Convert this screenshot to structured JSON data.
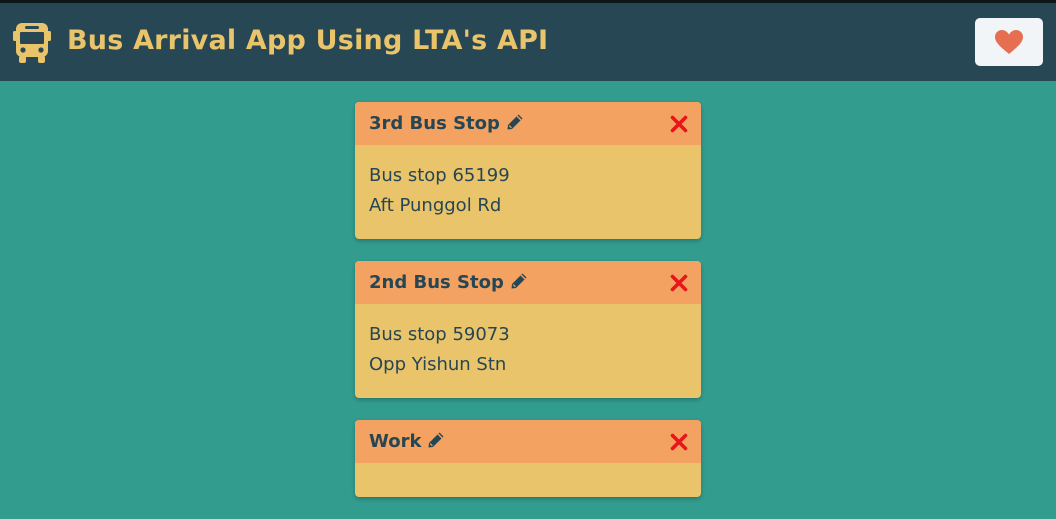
{
  "app": {
    "title": "Bus Arrival App Using LTA's API",
    "logo_icon": "bus-icon",
    "favorite_icon": "heart-icon"
  },
  "colors": {
    "background": "#329d8f",
    "navbar": "#274754",
    "title": "#e9c46a",
    "card_header": "#f4a261",
    "card_body": "#e9c46a",
    "text": "#264653",
    "delete": "#e8161b",
    "heart": "#e76f51"
  },
  "cards": [
    {
      "title": "3rd Bus Stop",
      "stop_line": "Bus stop 65199",
      "stop_name": "Aft Punggol Rd",
      "edit_icon": "pencil-icon",
      "delete_icon": "close-icon"
    },
    {
      "title": "2nd Bus Stop",
      "stop_line": "Bus stop 59073",
      "stop_name": "Opp Yishun Stn",
      "edit_icon": "pencil-icon",
      "delete_icon": "close-icon"
    },
    {
      "title": "Work",
      "stop_line": "",
      "stop_name": "",
      "edit_icon": "pencil-icon",
      "delete_icon": "close-icon"
    }
  ]
}
